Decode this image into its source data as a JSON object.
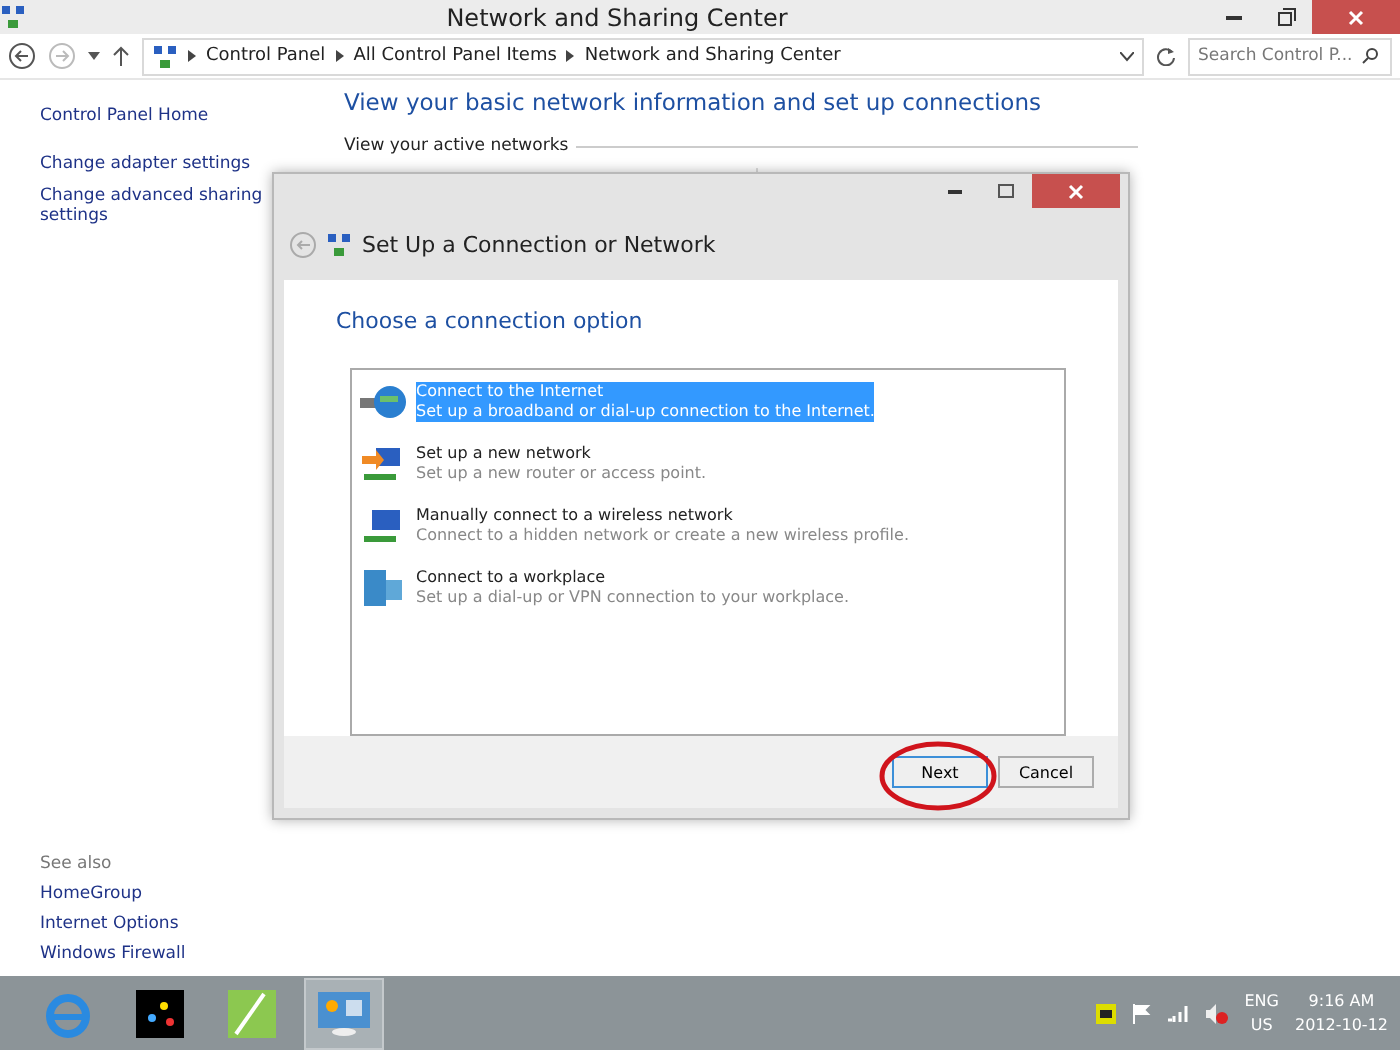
{
  "window": {
    "title": "Network and Sharing Center"
  },
  "address_bar": {
    "breadcrumbs": [
      "Control Panel",
      "All Control Panel Items",
      "Network and Sharing Center"
    ],
    "search_placeholder": "Search Control P..."
  },
  "sidebar": {
    "items": [
      "Control Panel Home",
      "Change adapter settings",
      "Change advanced sharing settings"
    ],
    "see_also": {
      "heading": "See also",
      "items": [
        "HomeGroup",
        "Internet Options",
        "Windows Firewall"
      ]
    }
  },
  "main": {
    "heading": "View your basic network information and set up connections",
    "section": "View your active networks"
  },
  "dialog": {
    "title": "Set Up a Connection or Network",
    "heading": "Choose a connection option",
    "options": [
      {
        "kind": "globe",
        "title": "Connect to the Internet",
        "description": "Set up a broadband or dial-up connection to the Internet.",
        "selected": true
      },
      {
        "kind": "router",
        "title": "Set up a new network",
        "description": "Set up a new router or access point.",
        "selected": false
      },
      {
        "kind": "wireless",
        "title": "Manually connect to a wireless network",
        "description": "Connect to a hidden network or create a new wireless profile.",
        "selected": false
      },
      {
        "kind": "workplace",
        "title": "Connect to a workplace",
        "description": "Set up a dial-up or VPN connection to your workplace.",
        "selected": false
      }
    ],
    "buttons": [
      {
        "label": "Next",
        "default": true
      },
      {
        "label": "Cancel",
        "default": false
      }
    ]
  },
  "taskbar": {
    "language": "ENG",
    "region": "US",
    "time": "9:16 AM",
    "date": "2012-10-12"
  }
}
